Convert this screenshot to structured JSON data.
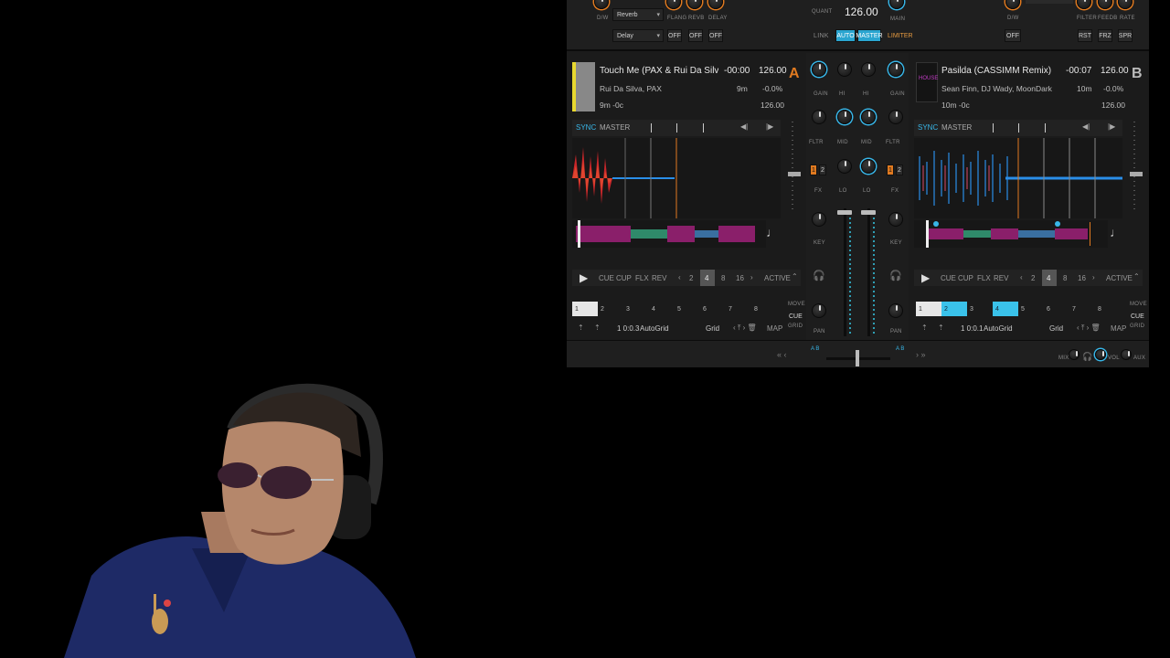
{
  "top": {
    "fx_label_dw": "D/W",
    "fx1_select": "Reverb",
    "fx2_select": "Delay",
    "fx_knob_labels": [
      "FLANG",
      "REVB",
      "DELAY"
    ],
    "off_buttons": [
      "OFF",
      "OFF",
      "OFF"
    ],
    "quant_label": "QUANT",
    "bpm": "126.00",
    "main_label": "MAIN",
    "link_label": "LINK",
    "auto_label": "AUTO",
    "master_label": "MASTER",
    "limiter_label": "LIMITER",
    "right_dw": "D/W",
    "right_off": "OFF",
    "right_knob_labels": [
      "FILTER",
      "FEEDB",
      "RATE"
    ],
    "right_buttons": [
      "RST",
      "FRZ",
      "SPR"
    ]
  },
  "deckA": {
    "title": "Touch Me (PAX & Rui Da Silva Exter",
    "artist": "Rui Da Silva, PAX",
    "key_info": "9m -0c",
    "time": "-00:00",
    "bpm": "126.00",
    "key": "9m",
    "pitch": "-0.0%",
    "bpm2": "126.00",
    "letter": "A",
    "sync": "SYNC",
    "master": "MASTER",
    "transport": [
      "CUE",
      "CUP",
      "FLX",
      "REV"
    ],
    "loops": [
      "‹",
      "2",
      "4",
      "8",
      "16",
      "›"
    ],
    "active": "ACTIVE",
    "pads": [
      "1",
      "2",
      "3",
      "4",
      "5",
      "6",
      "7",
      "8"
    ],
    "grid_pos": "1 0:0.3",
    "autogrid": "AutoGrid",
    "grid": "Grid",
    "map": "MAP",
    "move": "MOVE",
    "cue": "CUE",
    "gridlbl": "GRID"
  },
  "deckB": {
    "title": "Pasilda (CASSIMM Remix)",
    "artist": "Sean Finn, DJ Wady, MoonDark",
    "key_info": "10m -0c",
    "time": "-00:07",
    "bpm": "126.00",
    "key": "10m",
    "pitch": "-0.0%",
    "bpm2": "126.00",
    "letter": "B",
    "sync": "SYNC",
    "master": "MASTER",
    "transport": [
      "CUE",
      "CUP",
      "FLX",
      "REV"
    ],
    "loops": [
      "‹",
      "2",
      "4",
      "8",
      "16",
      "›"
    ],
    "active": "ACTIVE",
    "pads": [
      "1",
      "2",
      "3",
      "4",
      "5",
      "6",
      "7",
      "8"
    ],
    "grid_pos": "1 0:0.1",
    "autogrid": "AutoGrid",
    "grid": "Grid",
    "map": "MAP",
    "move": "MOVE",
    "cue": "CUE",
    "gridlbl": "GRID"
  },
  "mixer": {
    "gain": "GAIN",
    "hi": "HI",
    "mid": "MID",
    "lo": "LO",
    "fltr": "FLTR",
    "fx": "FX",
    "key": "KEY",
    "pan": "PAN",
    "fx1": "1",
    "fx2": "2"
  },
  "bottom": {
    "ab_left": "A B",
    "ab_right": "A B",
    "mix": "MIX",
    "vol": "VOL",
    "aux": "AUX"
  },
  "colors": {
    "accent_blue": "#2aa5d0",
    "accent_orange": "#e07a20",
    "waveform_red": "#c7262a",
    "waveform_blue": "#2a8ee8",
    "overview_purple": "#8a1f6a"
  }
}
